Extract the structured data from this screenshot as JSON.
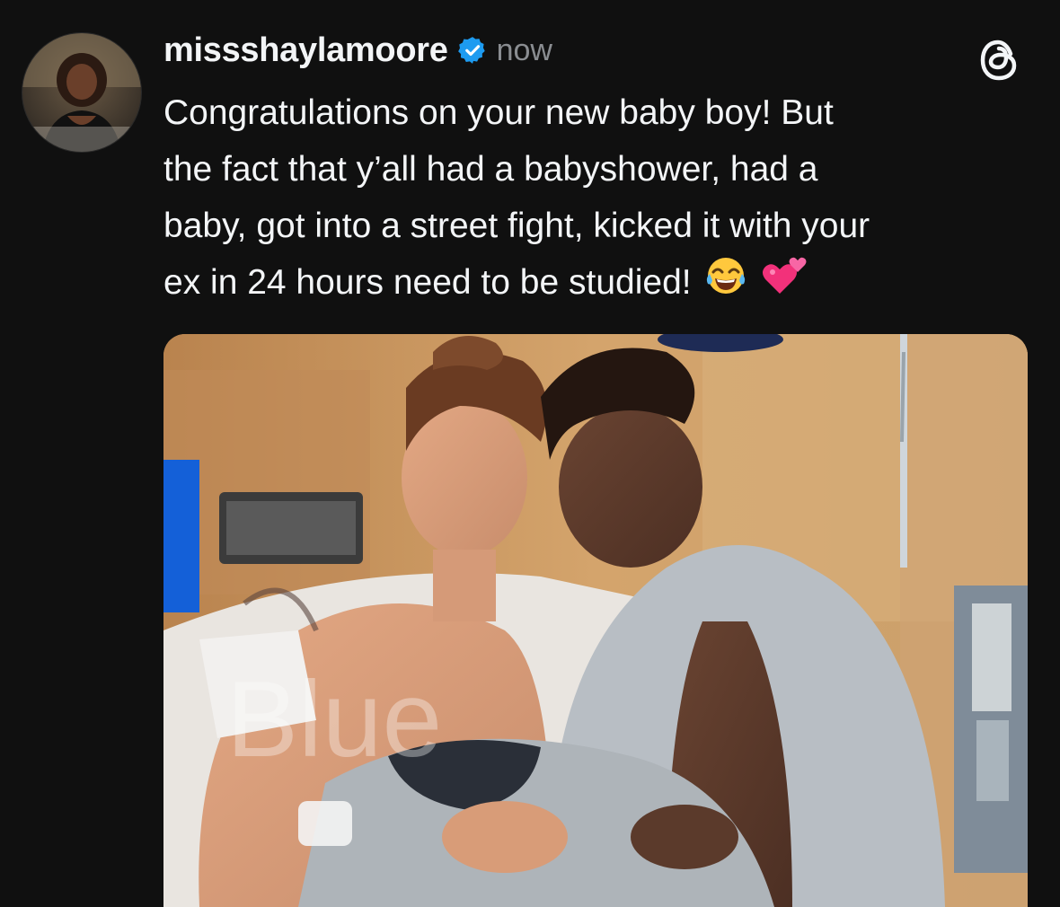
{
  "post": {
    "username": "missshaylamoore",
    "verified_icon": "verified-badge-icon",
    "timestamp": "now",
    "app_icon": "threads-logo-icon",
    "text": "Congratulations on your new baby boy! But\nthe fact that y’all had a babyshower, had a\nbaby, got into a street fight, kicked it with your\nex in 24 hours need to be studied!",
    "emojis": [
      "face-with-tears-of-joy",
      "two-hearts"
    ],
    "accent_color": "#1d9bf0",
    "media": {
      "watermark_text": "Blue"
    }
  }
}
